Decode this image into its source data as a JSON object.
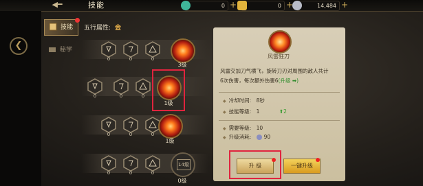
{
  "header": {
    "title": "技能",
    "resources": [
      {
        "icon": "jade-icon",
        "value": "0",
        "color": "#3fb69a"
      },
      {
        "icon": "gold-ingot-icon",
        "value": "0",
        "color": "#e2b43c"
      },
      {
        "icon": "silver-coin-icon",
        "value": "14,484",
        "color": "#b8bcc8"
      }
    ]
  },
  "tabs": [
    {
      "label": "技能",
      "active": true
    },
    {
      "label": "秘学",
      "active": false
    }
  ],
  "element": {
    "label": "五行属性:",
    "value": "金"
  },
  "skill_rows": [
    {
      "nodes": [
        "0",
        "0",
        "0"
      ],
      "level": "3级",
      "locked": false
    },
    {
      "nodes": [
        "0",
        "0",
        "0"
      ],
      "level": "1级",
      "locked": false,
      "selected": true
    },
    {
      "nodes": [
        "0",
        "0",
        "0"
      ],
      "level": "1级",
      "locked": false
    },
    {
      "nodes": [
        "0",
        "0",
        "0"
      ],
      "level": "0级",
      "locked": true,
      "lock_text": "14级"
    }
  ],
  "detail": {
    "name": "风雷狂刀",
    "description_1": "风雷交加刀气横飞，旋转刀刃对周围的敌人共计",
    "description_2": "6次伤害，每次额外伤害6",
    "description_green": "(升级 ➡)",
    "cooldown_label": "冷却时间:",
    "cooldown_value": "8秒",
    "skill_level_label": "技能等级:",
    "skill_level_value": "1",
    "skill_level_up": "2",
    "required_level_label": "需要等级:",
    "required_level_value": "10",
    "upgrade_cost_label": "升级消耗:",
    "upgrade_cost_value": "90"
  },
  "buttons": {
    "upgrade": "升 级",
    "one_click_upgrade": "一键升级"
  }
}
